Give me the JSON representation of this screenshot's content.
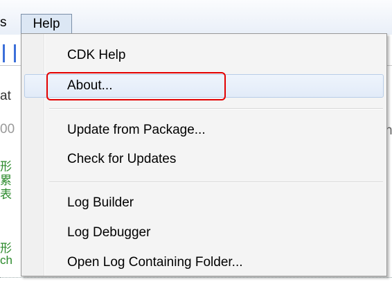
{
  "menubar": {
    "prev_menu_fragment": "s",
    "help_label": "Help"
  },
  "background": {
    "fragments": [
      "at",
      "00",
      "n",
      "形",
      "累",
      "表",
      "形",
      "ch"
    ]
  },
  "menu": {
    "items": [
      {
        "label": "CDK Help"
      },
      {
        "label": "About..."
      },
      {
        "label": "Update from Package..."
      },
      {
        "label": "Check for Updates"
      },
      {
        "label": "Log Builder"
      },
      {
        "label": "Log Debugger"
      },
      {
        "label": "Open Log Containing Folder..."
      }
    ],
    "highlighted_index": 1,
    "annotation_color": "#e30000"
  }
}
